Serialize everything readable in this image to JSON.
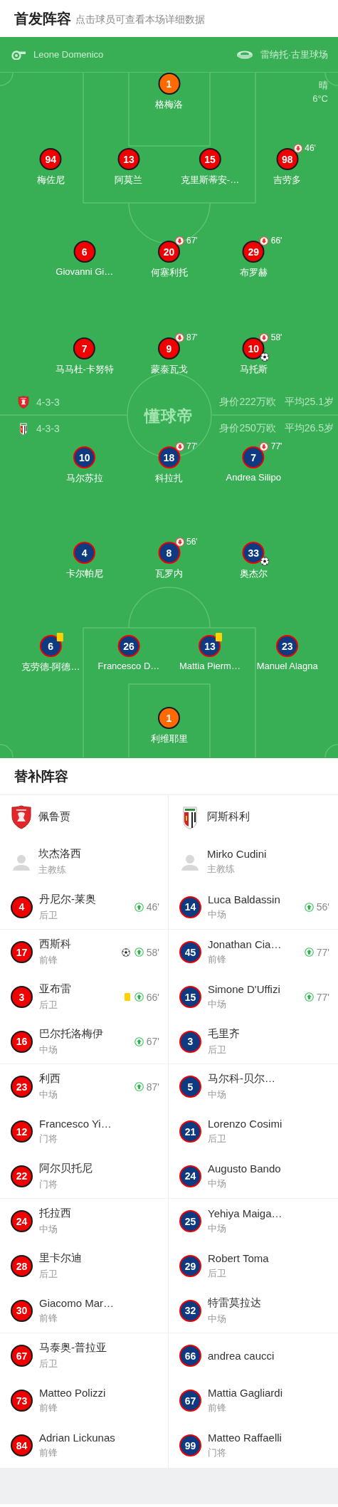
{
  "header": {
    "title": "首发阵容",
    "subtitle": "点击球员可查看本场详细数据"
  },
  "match_info": {
    "referee": "Leone Domenico",
    "stadium": "雷纳托·古里球场",
    "weather": "晴",
    "temperature": "6°C"
  },
  "pitch_logo": "懂球帝",
  "substitutes_title": "替补阵容",
  "teams": [
    {
      "kind": "home",
      "name": "佩鲁贾",
      "formation": "4-3-3",
      "market_value": "身价222万欧",
      "average_age": "平均25.1岁",
      "goalkeeper": {
        "number": "1",
        "name": "格梅洛",
        "goal": false,
        "yellow_card": false
      },
      "rows": [
        [
          {
            "number": "94",
            "name": "梅佐尼",
            "goal": false,
            "yellow_card": false
          },
          {
            "number": "13",
            "name": "阿莫兰",
            "goal": false,
            "yellow_card": false
          },
          {
            "number": "15",
            "name": "克里斯蒂安-…",
            "goal": false,
            "yellow_card": false
          },
          {
            "number": "98",
            "name": "吉劳多",
            "sub_off": "46'",
            "goal": false,
            "yellow_card": false
          }
        ],
        [
          {
            "number": "6",
            "name": "Giovanni Gi…",
            "goal": false,
            "yellow_card": false
          },
          {
            "number": "20",
            "name": "何塞利托",
            "sub_off": "67'",
            "goal": false,
            "yellow_card": false
          },
          {
            "number": "29",
            "name": "布罗赫",
            "sub_off": "66'",
            "goal": false,
            "yellow_card": false
          }
        ],
        [
          {
            "number": "7",
            "name": "马马杜-卡努特",
            "goal": false,
            "yellow_card": false
          },
          {
            "number": "9",
            "name": "蒙泰瓦戈",
            "sub_off": "87'",
            "goal": false,
            "yellow_card": false
          },
          {
            "number": "10",
            "name": "马托斯",
            "sub_off": "58'",
            "goal": true,
            "yellow_card": false
          }
        ]
      ],
      "coach": {
        "name": "坎杰洛西",
        "role": "主教练"
      },
      "substitutes": [
        {
          "number": "4",
          "name": "丹尼尔-莱奥",
          "position": "后卫",
          "sub_on": "46'",
          "goal": false,
          "yellow_card": false
        },
        {
          "number": "17",
          "name": "西斯科",
          "position": "前锋",
          "sub_on": "58'",
          "goal": true,
          "yellow_card": false
        },
        {
          "number": "3",
          "name": "亚布雷",
          "position": "后卫",
          "sub_on": "66'",
          "goal": false,
          "yellow_card": true
        },
        {
          "number": "16",
          "name": "巴尔托洛梅伊",
          "position": "中场",
          "sub_on": "67'",
          "goal": false,
          "yellow_card": false
        },
        {
          "number": "23",
          "name": "利西",
          "position": "中场",
          "sub_on": "87'",
          "goal": false,
          "yellow_card": false
        },
        {
          "number": "12",
          "name": "Francesco Yi…",
          "position": "门将",
          "goal": false,
          "yellow_card": false
        },
        {
          "number": "22",
          "name": "阿尔贝托尼",
          "position": "门将",
          "goal": false,
          "yellow_card": false
        },
        {
          "number": "24",
          "name": "托拉西",
          "position": "中场",
          "goal": false,
          "yellow_card": false
        },
        {
          "number": "28",
          "name": "里卡尔迪",
          "position": "后卫",
          "goal": false,
          "yellow_card": false
        },
        {
          "number": "30",
          "name": "Giacomo Mar…",
          "position": "前锋",
          "goal": false,
          "yellow_card": false
        },
        {
          "number": "67",
          "name": "马泰奥-普拉亚",
          "position": "后卫",
          "goal": false,
          "yellow_card": false
        },
        {
          "number": "73",
          "name": "Matteo Polizzi",
          "position": "前锋",
          "goal": false,
          "yellow_card": false
        },
        {
          "number": "84",
          "name": "Adrian Lickunas",
          "position": "前锋",
          "goal": false,
          "yellow_card": false
        }
      ]
    },
    {
      "kind": "away",
      "name": "阿斯科利",
      "formation": "4-3-3",
      "market_value": "身价250万欧",
      "average_age": "平均26.5岁",
      "goalkeeper": {
        "number": "1",
        "name": "利维耶里",
        "goal": false,
        "yellow_card": false
      },
      "rows": [
        [
          {
            "number": "10",
            "name": "马尔苏拉",
            "goal": false,
            "yellow_card": false
          },
          {
            "number": "18",
            "name": "科拉扎",
            "sub_off": "77'",
            "goal": false,
            "yellow_card": false
          },
          {
            "number": "7",
            "name": "Andrea Silipo",
            "sub_off": "77'",
            "goal": false,
            "yellow_card": false
          }
        ],
        [
          {
            "number": "4",
            "name": "卡尔帕尼",
            "goal": false,
            "yellow_card": false
          },
          {
            "number": "8",
            "name": "瓦罗内",
            "sub_off": "56'",
            "goal": false,
            "yellow_card": false
          },
          {
            "number": "33",
            "name": "奥杰尔",
            "goal": true,
            "yellow_card": false
          }
        ],
        [
          {
            "number": "6",
            "name": "克劳德-阿德…",
            "goal": false,
            "yellow_card": true
          },
          {
            "number": "26",
            "name": "Francesco D…",
            "goal": false,
            "yellow_card": false
          },
          {
            "number": "13",
            "name": "Mattia Pierm…",
            "goal": false,
            "yellow_card": true
          },
          {
            "number": "23",
            "name": "Manuel Alagna",
            "goal": false,
            "yellow_card": false
          }
        ]
      ],
      "coach": {
        "name": "Mirko Cudini",
        "role": "主教练"
      },
      "substitutes": [
        {
          "number": "14",
          "name": "Luca Baldassin",
          "position": "中场",
          "sub_on": "56'",
          "goal": false,
          "yellow_card": false
        },
        {
          "number": "45",
          "name": "Jonathan Cia…",
          "position": "前锋",
          "sub_on": "77'",
          "goal": false,
          "yellow_card": false
        },
        {
          "number": "15",
          "name": "Simone D'Uffizi",
          "position": "中场",
          "sub_on": "77'",
          "goal": false,
          "yellow_card": false
        },
        {
          "number": "3",
          "name": "毛里齐",
          "position": "后卫",
          "goal": false,
          "yellow_card": false
        },
        {
          "number": "5",
          "name": "马尔科-贝尔…",
          "position": "中场",
          "goal": false,
          "yellow_card": false
        },
        {
          "number": "21",
          "name": "Lorenzo Cosimi",
          "position": "后卫",
          "goal": false,
          "yellow_card": false
        },
        {
          "number": "24",
          "name": "Augusto Bando",
          "position": "中场",
          "goal": false,
          "yellow_card": false
        },
        {
          "number": "25",
          "name": "Yehiya Maiga…",
          "position": "中场",
          "goal": false,
          "yellow_card": false
        },
        {
          "number": "29",
          "name": "Robert Toma",
          "position": "后卫",
          "goal": false,
          "yellow_card": false
        },
        {
          "number": "32",
          "name": "特雷莫拉达",
          "position": "中场",
          "goal": false,
          "yellow_card": false
        },
        {
          "number": "66",
          "name": "andrea caucci",
          "goal": false,
          "yellow_card": false
        },
        {
          "number": "67",
          "name": "Mattia Gagliardi",
          "position": "前锋",
          "goal": false,
          "yellow_card": false
        },
        {
          "number": "99",
          "name": "Matteo Raffaelli",
          "position": "门将",
          "goal": false,
          "yellow_card": false
        }
      ]
    }
  ]
}
